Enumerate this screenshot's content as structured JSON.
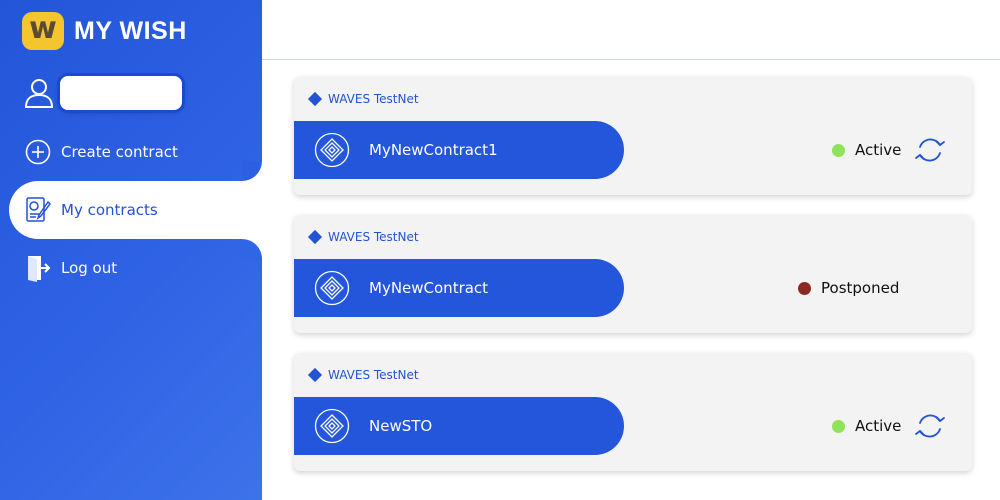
{
  "app": {
    "logo_glyph": "w",
    "title": "MY WISH",
    "accent": "#2456dc",
    "logo_color": "#f4c52f"
  },
  "sidebar": {
    "user_icon": "user-icon",
    "username": "",
    "items": [
      {
        "label": "Create contract",
        "icon": "plus-circle-icon",
        "active": false
      },
      {
        "label": "My contracts",
        "icon": "contract-document-icon",
        "active": true
      },
      {
        "label": "Log out",
        "icon": "logout-door-icon",
        "active": false
      }
    ]
  },
  "contracts": [
    {
      "network": "WAVES TestNet",
      "name": "MyNewContract1",
      "status": "Active",
      "status_color": "#8ee35a",
      "refresh": true
    },
    {
      "network": "WAVES TestNet",
      "name": "MyNewContract",
      "status": "Postponed",
      "status_color": "#8b2a1f",
      "refresh": false
    },
    {
      "network": "WAVES TestNet",
      "name": "NewSTO",
      "status": "Active",
      "status_color": "#8ee35a",
      "refresh": true
    }
  ]
}
